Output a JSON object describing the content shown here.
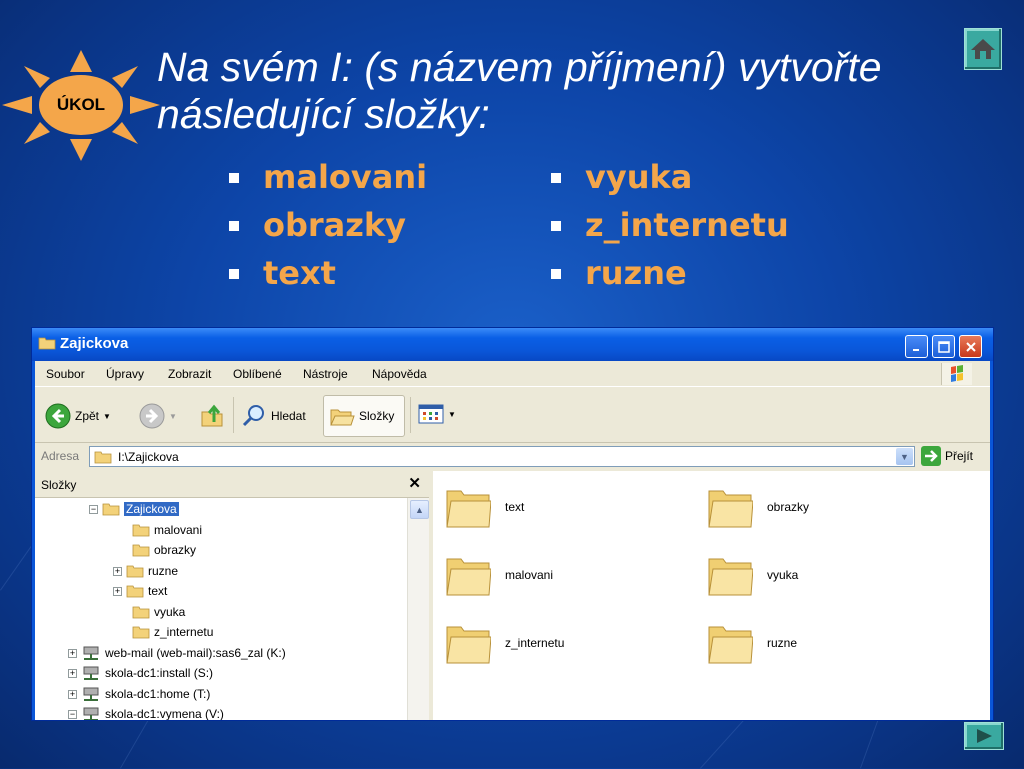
{
  "slide": {
    "badge": "ÚKOL",
    "title_line1": "Na svém I: (s názvem příjmení) vytvořte",
    "title_line2": "následující složky:",
    "bullets_left": [
      "malovani",
      "obrazky",
      "text"
    ],
    "bullets_right": [
      "vyuka",
      "z_internetu",
      "ruzne"
    ],
    "home_icon": "home-icon",
    "next_icon": "next-arrow-icon"
  },
  "window": {
    "title": "Zajickova",
    "menu": [
      "Soubor",
      "Úpravy",
      "Zobrazit",
      "Oblíbené",
      "Nástroje",
      "Nápověda"
    ],
    "toolbar": {
      "back": "Zpět",
      "search": "Hledat",
      "folders": "Složky"
    },
    "address": {
      "label": "Adresa",
      "value": "I:\\Zajickova",
      "go": "Přejít"
    },
    "folders_pane": {
      "title": "Složky",
      "tree": [
        {
          "label": "Zajickova",
          "expander": "−",
          "selected": true
        },
        {
          "label": "malovani",
          "expander": ""
        },
        {
          "label": "obrazky",
          "expander": ""
        },
        {
          "label": "ruzne",
          "expander": "+"
        },
        {
          "label": "text",
          "expander": "+"
        },
        {
          "label": "vyuka",
          "expander": ""
        },
        {
          "label": "z_internetu",
          "expander": ""
        },
        {
          "label": "web-mail (web-mail):sas6_zal (K:)",
          "expander": "+"
        },
        {
          "label": "skola-dc1:install (S:)",
          "expander": "+"
        },
        {
          "label": "skola-dc1:home (T:)",
          "expander": "+"
        },
        {
          "label": "skola-dc1:vymena (V:)",
          "expander": "−"
        }
      ]
    },
    "files": [
      "text",
      "obrazky",
      "malovani",
      "vyuka",
      "z_internetu",
      "ruzne"
    ]
  },
  "colors": {
    "bullet_text": "#f4a64a",
    "selection": "#316ac5",
    "title_bar": "#0a56d8"
  }
}
